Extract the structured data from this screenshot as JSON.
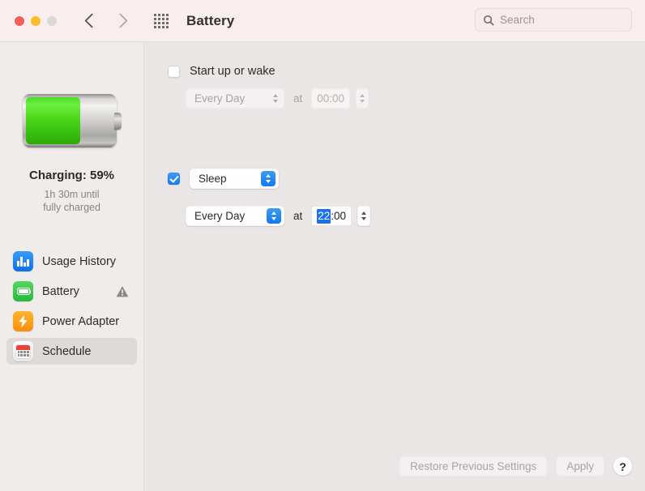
{
  "window": {
    "title": "Battery",
    "traffic_lights": [
      "close",
      "minimize",
      "zoom"
    ],
    "nav_back_icon": "chevron-left-icon",
    "nav_forward_icon": "chevron-right-icon",
    "grid_icon": "grid-apps-icon"
  },
  "search": {
    "placeholder": "Search",
    "icon": "search-icon"
  },
  "sidebar": {
    "battery": {
      "icon": "battery-status-icon",
      "percent": 59,
      "status": "Charging: 59%",
      "time_remaining_line1": "1h 30m until",
      "time_remaining_line2": "fully charged"
    },
    "items": [
      {
        "label": "Usage History",
        "icon": "usage-history-icon",
        "selected": false,
        "warning": false
      },
      {
        "label": "Battery",
        "icon": "battery-icon",
        "selected": false,
        "warning": true,
        "warning_icon": "warning-triangle-icon"
      },
      {
        "label": "Power Adapter",
        "icon": "power-adapter-icon",
        "selected": false,
        "warning": false
      },
      {
        "label": "Schedule",
        "icon": "schedule-calendar-icon",
        "selected": true,
        "warning": false
      }
    ]
  },
  "main": {
    "startup": {
      "checkbox_label": "Start up or wake",
      "checked": false,
      "enabled": false,
      "day_value": "Every Day",
      "at_label": "at",
      "time_value": "00:00"
    },
    "sleep": {
      "checked": true,
      "enabled": true,
      "action_value": "Sleep",
      "day_value": "Every Day",
      "at_label": "at",
      "time_hours": "22",
      "time_minutes": ":00"
    }
  },
  "footer": {
    "restore_label": "Restore Previous Settings",
    "apply_label": "Apply",
    "help_label": "?"
  },
  "colors": {
    "accent_blue": "#1279ef",
    "battery_green": "#49d516",
    "titlebar": "#f9eeee",
    "sidebar": "#efeceb",
    "content": "#e9e6e5"
  }
}
